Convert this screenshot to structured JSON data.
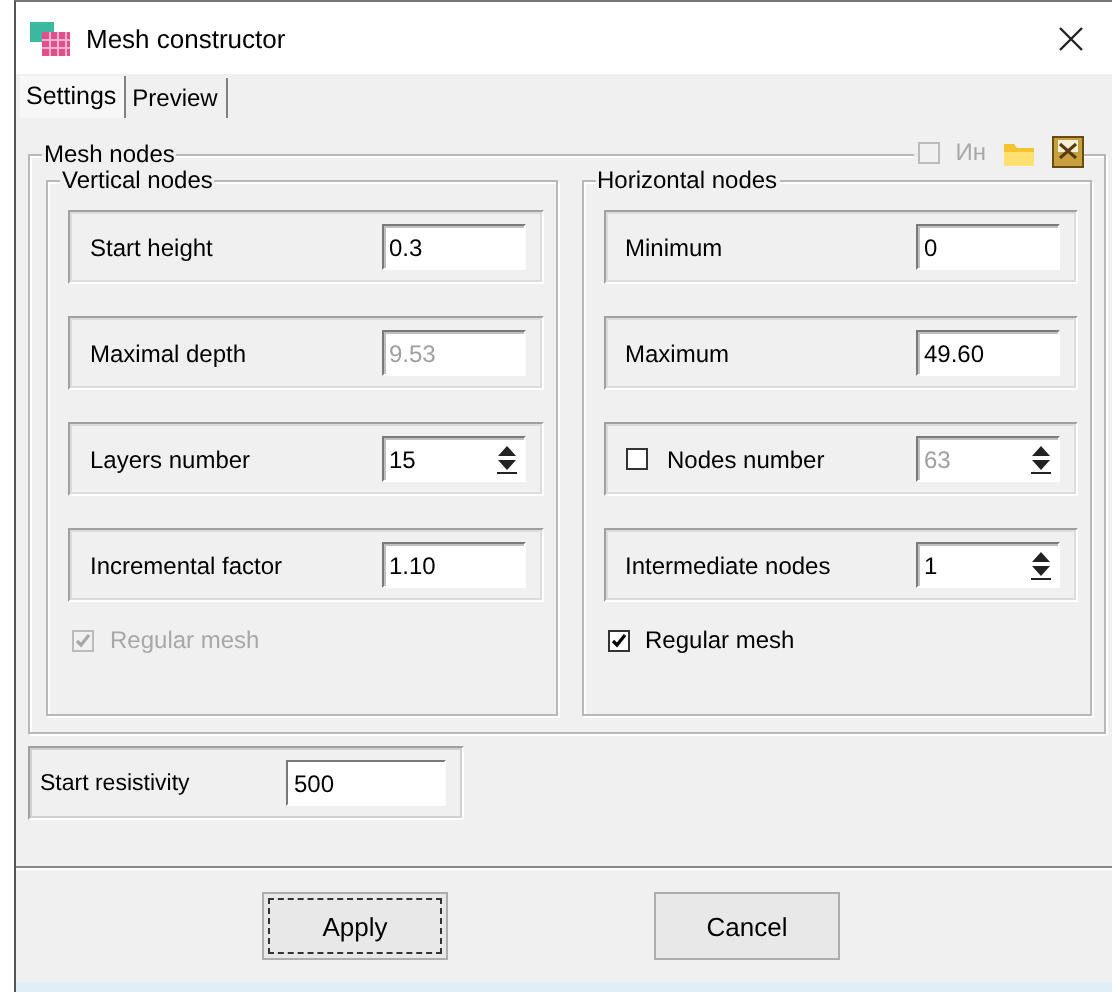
{
  "window": {
    "title": "Mesh constructor"
  },
  "tabs": [
    {
      "label": "Settings",
      "selected": true
    },
    {
      "label": "Preview",
      "selected": false
    }
  ],
  "mesh_nodes": {
    "title": "Mesh nodes",
    "toolbar_check": {
      "label": "Ин",
      "checked": false,
      "disabled": true
    },
    "vertical": {
      "title": "Vertical nodes",
      "rows": [
        {
          "kind": "text",
          "label": "Start height",
          "value": "0.3",
          "disabled": false
        },
        {
          "kind": "text",
          "label": "Maximal depth",
          "value": "9.53",
          "disabled": true
        },
        {
          "kind": "spin",
          "label": "Layers number",
          "value": "15",
          "disabled": false
        },
        {
          "kind": "text",
          "label": "Incremental factor",
          "value": "1.10",
          "disabled": false
        }
      ],
      "regular_mesh": {
        "label": "Regular mesh",
        "checked": true,
        "disabled": true
      }
    },
    "horizontal": {
      "title": "Horizontal nodes",
      "rows": [
        {
          "kind": "text",
          "label": "Minimum",
          "value": "0",
          "disabled": false
        },
        {
          "kind": "text",
          "label": "Maximum",
          "value": "49.60",
          "disabled": false
        },
        {
          "kind": "check-spin",
          "label": "Nodes number",
          "value": "63",
          "disabled": true,
          "checked": false
        },
        {
          "kind": "spin",
          "label": "Intermediate nodes",
          "value": "1",
          "disabled": false
        }
      ],
      "regular_mesh": {
        "label": "Regular mesh",
        "checked": true,
        "disabled": false
      }
    }
  },
  "start_resistivity": {
    "label": "Start resistivity",
    "value": "500"
  },
  "buttons": [
    {
      "label": "Apply",
      "focused": true
    },
    {
      "label": "Cancel",
      "focused": false
    }
  ]
}
